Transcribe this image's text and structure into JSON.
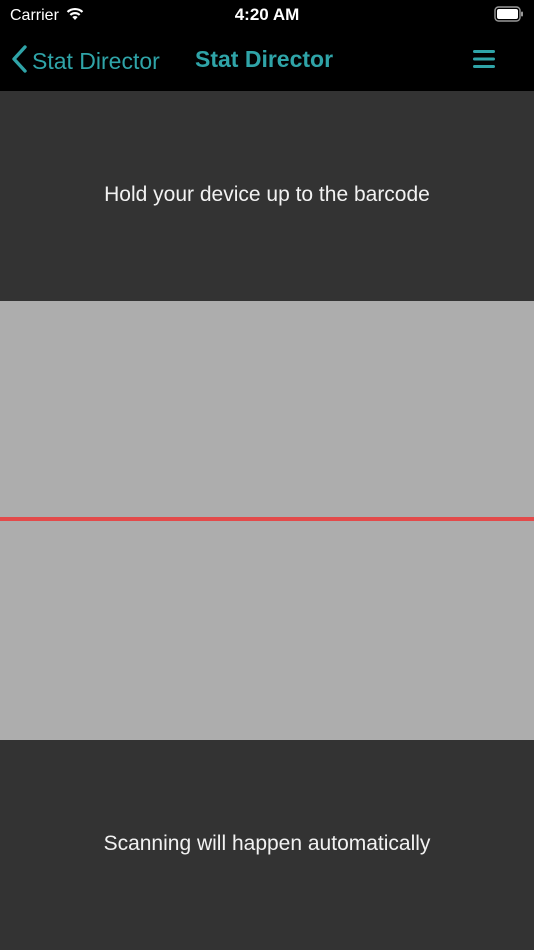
{
  "status_bar": {
    "carrier": "Carrier",
    "time": "4:20 AM",
    "icons": [
      "wifi-icon",
      "battery-icon"
    ]
  },
  "nav": {
    "back_label": "Stat Director",
    "title": "Stat Director",
    "back_icon": "chevron-left-icon",
    "menu_icon": "hamburger-menu-icon",
    "accent_color": "#2fa4a8"
  },
  "scanner": {
    "instruction": "Hold your device up to the barcode",
    "auto_note": "Scanning will happen automatically",
    "scan_line_color": "#e34a4a",
    "panel_color": "#333333",
    "viewfinder_color": "#adadad"
  }
}
